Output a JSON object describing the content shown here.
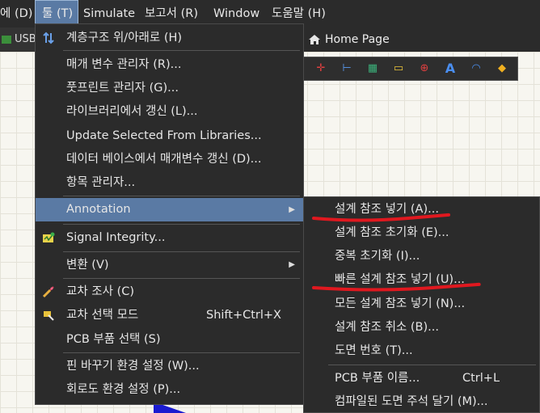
{
  "menubar": {
    "items": [
      "에 (D)",
      "툴 (T)",
      "Simulate",
      "보고서 (R)",
      "Window",
      "도움말 (H)"
    ]
  },
  "tabs": {
    "usb": "USB",
    "home": "Home Page"
  },
  "tools_menu": {
    "items": [
      {
        "label": "계층구조 위/아래로 (H)",
        "icon": "hierarchy-up-down-icon"
      },
      {
        "label": "매개 변수 관리자 (R)..."
      },
      {
        "label": "풋프린트 관리자 (G)..."
      },
      {
        "label": "라이브러리에서 갱신 (L)..."
      },
      {
        "label": "Update Selected From Libraries..."
      },
      {
        "label": "데이터 베이스에서 매개변수 갱신 (D)..."
      },
      {
        "label": "항목 관리자..."
      },
      {
        "label": "Annotation",
        "submenu": true
      },
      {
        "label": "Signal Integrity...",
        "icon": "signal-integrity-icon"
      },
      {
        "label": "변환 (V)",
        "submenu": true
      },
      {
        "label": "교차 조사 (C)",
        "icon": "cross-probe-icon"
      },
      {
        "label": "교차 선택 모드",
        "shortcut": "Shift+Ctrl+X",
        "icon": "cross-select-icon"
      },
      {
        "label": "PCB 부품 선택 (S)"
      },
      {
        "label": "핀 바꾸기 환경 설정 (W)..."
      },
      {
        "label": "회로도 환경 설정 (P)..."
      }
    ]
  },
  "annotation_menu": {
    "items": [
      {
        "label": "설계 참조 넣기 (A)..."
      },
      {
        "label": "설계 참조 초기화 (E)..."
      },
      {
        "label": "중복 초기화 (I)..."
      },
      {
        "label": "빠른 설계 참조 넣기 (U)..."
      },
      {
        "label": "모든 설계 참조 넣기 (N)..."
      },
      {
        "label": "설계 참조 취소 (B)..."
      },
      {
        "label": "도면 번호 (T)..."
      },
      {
        "label": "PCB 부품 이름...",
        "shortcut": "Ctrl+L"
      },
      {
        "label": "컴파일된 도면 주석 달기 (M)..."
      }
    ]
  },
  "colors": {
    "highlight": "#5a7aa4",
    "menu_bg": "#2b2b2b",
    "annotation_mark": "#e0181f",
    "wire": "#1b1bd0"
  }
}
